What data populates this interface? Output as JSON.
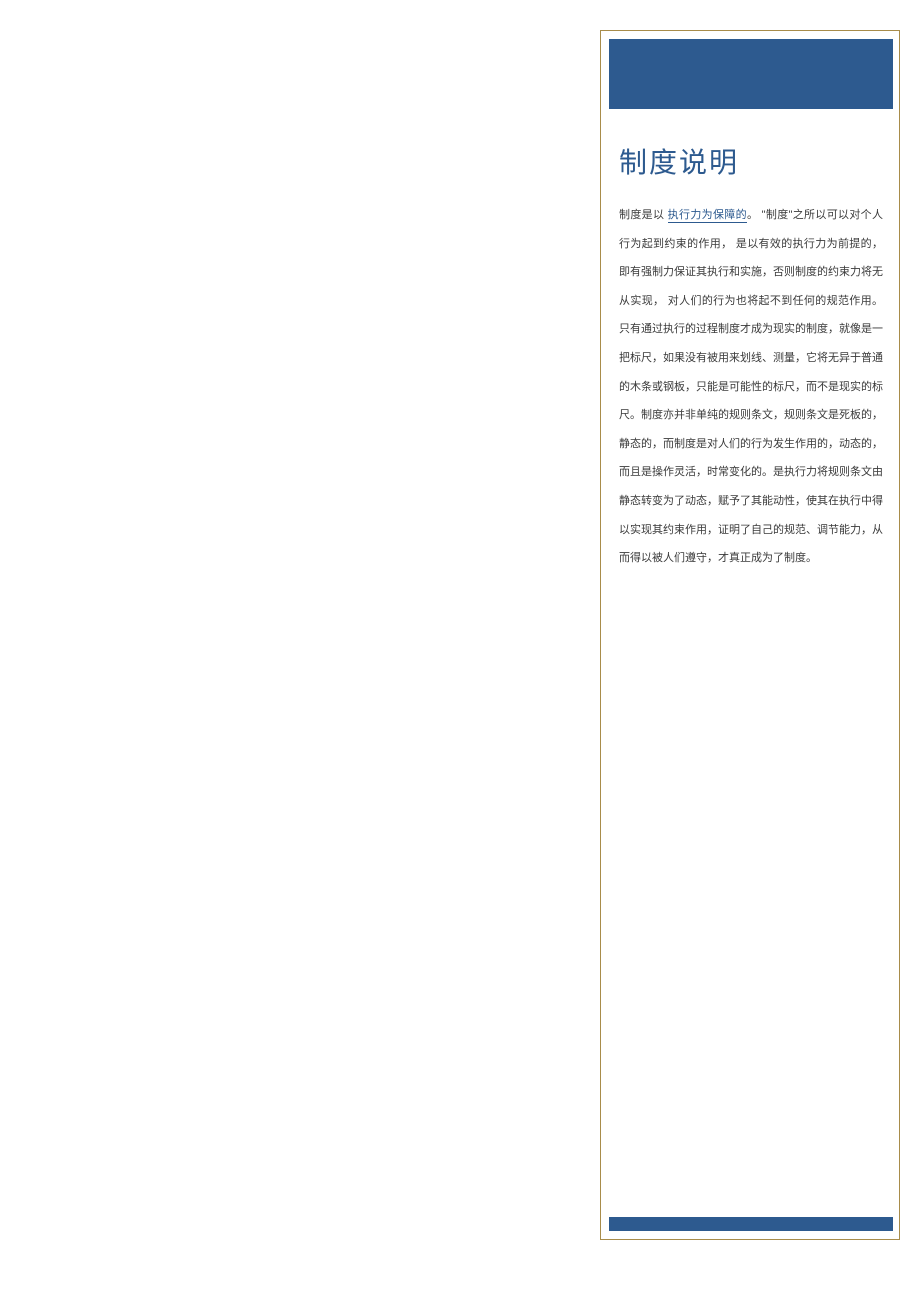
{
  "title": "制度说明",
  "body": {
    "prefix": "制度是以 ",
    "linked": "执行力为保障的",
    "rest": "。 \"制度\"之所以可以对个人行为起到约束的作用，  是以有效的执行力为前提的，即有强制力保证其执行和实施，否则制度的约束力将无从实现，  对人们的行为也将起不到任何的规范作用。  只有通过执行的过程制度才成为现实的制度，就像是一把标尺，如果没有被用来划线、测量，它将无异于普通的木条或钢板，只能是可能性的标尺，而不是现实的标尺。制度亦并非单纯的规则条文，规则条文是死板的，静态的，而制度是对人们的行为发生作用的，动态的，而且是操作灵活，时常变化的。是执行力将规则条文由静态转变为了动态，赋予了其能动性，使其在执行中得以实现其约束作用，证明了自己的规范、调节能力，从而得以被人们遵守，才真正成为了制度。"
  }
}
